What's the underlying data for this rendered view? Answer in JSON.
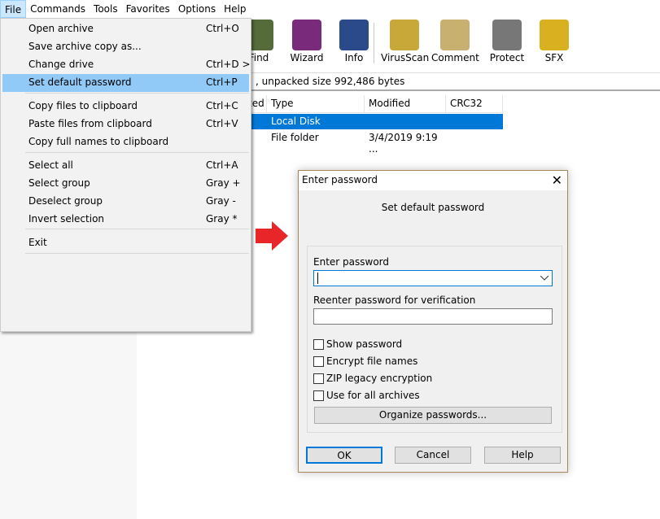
{
  "menubar": [
    "File",
    "Commands",
    "Tools",
    "Favorites",
    "Options",
    "Help"
  ],
  "toolbar": [
    {
      "label": "Find",
      "icon": "find-icon",
      "color": "#556b3a"
    },
    {
      "label": "Wizard",
      "icon": "wizard-icon",
      "color": "#7a2a7a"
    },
    {
      "label": "Info",
      "icon": "info-icon",
      "color": "#2a4a8a"
    },
    {
      "label": "VirusScan",
      "icon": "virusscan-icon",
      "color": "#c8a838"
    },
    {
      "label": "Comment",
      "icon": "comment-icon",
      "color": "#c8b070"
    },
    {
      "label": "Protect",
      "icon": "protect-icon",
      "color": "#777"
    },
    {
      "label": "SFX",
      "icon": "sfx-icon",
      "color": "#d8b020"
    }
  ],
  "status": ", unpacked size 992,486 bytes",
  "list": {
    "headers": [
      "ted",
      "Type",
      "Modified",
      "CRC32"
    ],
    "rows": [
      [
        "Local Disk",
        ""
      ],
      [
        "File folder",
        "3/4/2019 9:19 ..."
      ]
    ],
    "selected_color": "#0078d7"
  },
  "file_menu": [
    {
      "label": "Open archive",
      "shortcut": "Ctrl+O"
    },
    {
      "label": "Save archive copy as...",
      "shortcut": ""
    },
    {
      "label": "Change drive",
      "shortcut": "Ctrl+D >"
    },
    {
      "label": "Set default password",
      "shortcut": "Ctrl+P"
    },
    {
      "label": "Copy files to clipboard",
      "shortcut": "Ctrl+C"
    },
    {
      "label": "Paste files from clipboard",
      "shortcut": "Ctrl+V"
    },
    {
      "label": "Copy full names to clipboard",
      "shortcut": ""
    },
    {
      "label": "Select all",
      "shortcut": "Ctrl+A"
    },
    {
      "label": "Select group",
      "shortcut": "Gray +"
    },
    {
      "label": "Deselect group",
      "shortcut": "Gray -"
    },
    {
      "label": "Invert selection",
      "shortcut": "Gray *"
    },
    {
      "label": "Exit",
      "shortcut": ""
    }
  ],
  "dialog": {
    "title": "Enter password",
    "subtitle": "Set default password",
    "enter_label": "Enter password",
    "enter_value": "",
    "reenter_label": "Reenter password for verification",
    "reenter_value": "",
    "checkboxes": [
      {
        "label": "Show password",
        "checked": false
      },
      {
        "label": "Encrypt file names",
        "checked": false
      },
      {
        "label": "ZIP legacy encryption",
        "checked": false
      },
      {
        "label": "Use for all archives",
        "checked": false
      }
    ],
    "organize": "Organize passwords...",
    "ok": "OK",
    "cancel": "Cancel",
    "help": "Help"
  },
  "arrow_color": "#e8262a"
}
